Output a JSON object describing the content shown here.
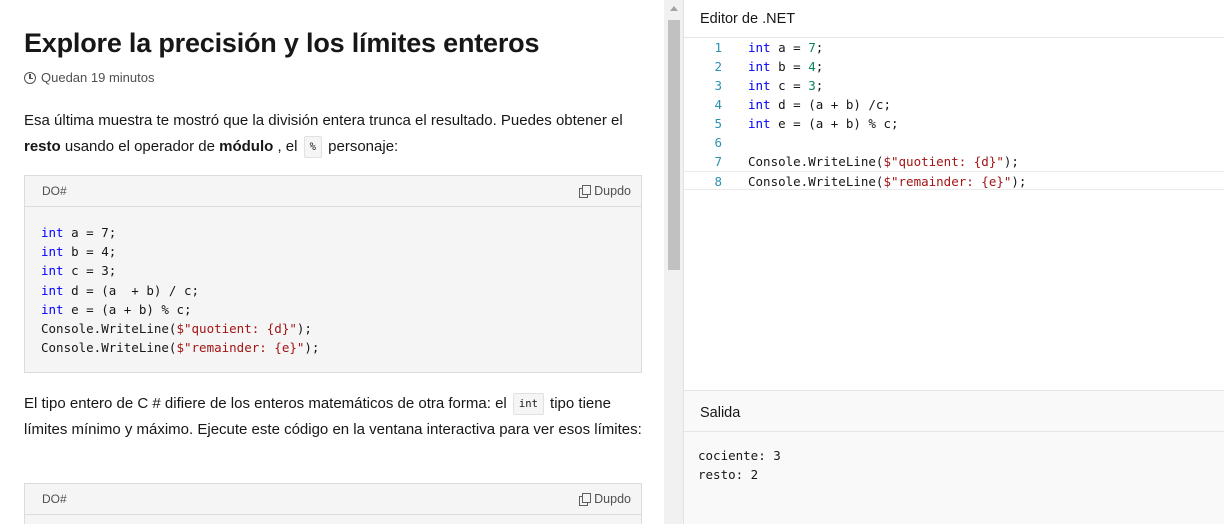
{
  "article": {
    "title": "Explore la precisión y los límites enteros",
    "time_remaining": "Quedan 19 minutos",
    "para1": {
      "t1": "Esa última muestra te mostró que la división entera trunca el resultado. Puedes obtener el ",
      "b1": "resto",
      "t2": " usando el operador de ",
      "b2": "módulo",
      "t3": " , el ",
      "code": "%",
      "t4": " personaje:"
    },
    "code1": {
      "lang": "DO#",
      "copy_label": "Dupdo",
      "lines": [
        [
          {
            "c": "kw",
            "t": "int"
          },
          {
            "c": "",
            "t": " a = 7;"
          }
        ],
        [
          {
            "c": "kw",
            "t": "int"
          },
          {
            "c": "",
            "t": " b = 4;"
          }
        ],
        [
          {
            "c": "kw",
            "t": "int"
          },
          {
            "c": "",
            "t": " c = 3;"
          }
        ],
        [
          {
            "c": "kw",
            "t": "int"
          },
          {
            "c": "",
            "t": " d = (a  + b) / c;"
          }
        ],
        [
          {
            "c": "kw",
            "t": "int"
          },
          {
            "c": "",
            "t": " e = (a + b) % c;"
          }
        ],
        [
          {
            "c": "",
            "t": "Console.WriteLine("
          },
          {
            "c": "str",
            "t": "$\"quotient: {d}\""
          },
          {
            "c": "",
            "t": ");"
          }
        ],
        [
          {
            "c": "",
            "t": "Console.WriteLine("
          },
          {
            "c": "str",
            "t": "$\"remainder: {e}\""
          },
          {
            "c": "",
            "t": ");"
          }
        ]
      ]
    },
    "para2": {
      "t1": "El tipo entero de C # difiere de los enteros matemáticos de otra forma: el ",
      "code": "int",
      "t2": " tipo tiene límites mínimo y máximo. Ejecute este código en la ventana interactiva para ver esos límites:"
    },
    "code2": {
      "lang": "DO#",
      "copy_label": "Dupdo"
    }
  },
  "editor": {
    "title": "Editor de .NET",
    "lines": [
      {
        "n": "1",
        "parts": [
          {
            "c": "kw",
            "t": "int"
          },
          {
            "c": "",
            "t": " a = "
          },
          {
            "c": "num",
            "t": "7"
          },
          {
            "c": "",
            "t": ";"
          }
        ]
      },
      {
        "n": "2",
        "parts": [
          {
            "c": "kw",
            "t": "int"
          },
          {
            "c": "",
            "t": " b = "
          },
          {
            "c": "num",
            "t": "4"
          },
          {
            "c": "",
            "t": ";"
          }
        ]
      },
      {
        "n": "3",
        "parts": [
          {
            "c": "kw",
            "t": "int"
          },
          {
            "c": "",
            "t": " c = "
          },
          {
            "c": "num",
            "t": "3"
          },
          {
            "c": "",
            "t": ";"
          }
        ]
      },
      {
        "n": "4",
        "parts": [
          {
            "c": "kw",
            "t": "int"
          },
          {
            "c": "",
            "t": " d = (a + b) /c;"
          }
        ]
      },
      {
        "n": "5",
        "parts": [
          {
            "c": "kw",
            "t": "int"
          },
          {
            "c": "",
            "t": " e = (a + b) % c;"
          }
        ]
      },
      {
        "n": "6",
        "parts": []
      },
      {
        "n": "7",
        "parts": [
          {
            "c": "",
            "t": "Console.WriteLine("
          },
          {
            "c": "str",
            "t": "$\"quotient: {d}\""
          },
          {
            "c": "",
            "t": ");"
          }
        ]
      },
      {
        "n": "8",
        "parts": [
          {
            "c": "",
            "t": "Console.WriteLine("
          },
          {
            "c": "str",
            "t": "$\"remainder: {e}\""
          },
          {
            "c": "",
            "t": ");"
          }
        ]
      }
    ]
  },
  "output": {
    "title": "Salida",
    "lines": [
      "cociente: 3",
      "resto: 2"
    ]
  },
  "colors": {
    "keyword": "#0000ff",
    "string": "#a31515",
    "number": "#098658",
    "line_number": "#2b91af"
  }
}
